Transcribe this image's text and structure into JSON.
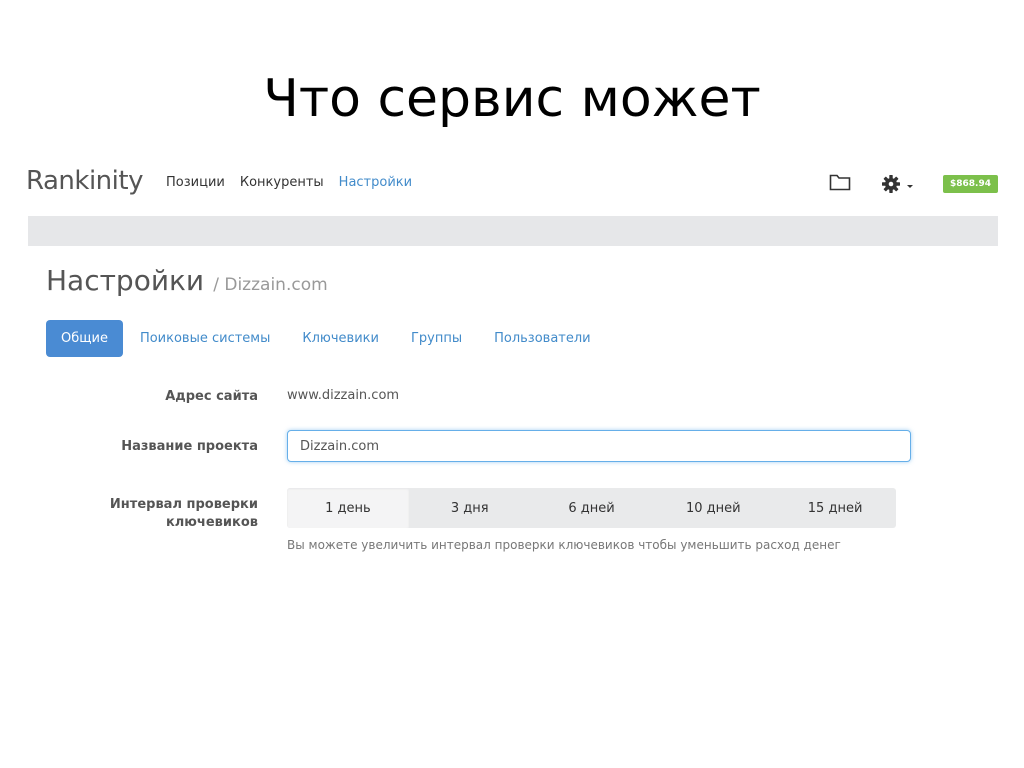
{
  "slide": {
    "title": "Что сервис может"
  },
  "navbar": {
    "brand": "Rankinity",
    "links": [
      {
        "label": "Позиции",
        "active": false
      },
      {
        "label": "Конкуренты",
        "active": false
      },
      {
        "label": "Настройки",
        "active": true
      }
    ],
    "icons": [
      "folder-icon",
      "gear-icon",
      "caret-down-icon"
    ],
    "balance": "$868.94",
    "balance_color": "#7cc04b"
  },
  "page": {
    "title": "Настройки",
    "subtitle": "/ Dizzain.com"
  },
  "tabs": [
    {
      "label": "Общие",
      "active": true
    },
    {
      "label": "Поиковые системы",
      "active": false
    },
    {
      "label": "Ключевики",
      "active": false
    },
    {
      "label": "Группы",
      "active": false
    },
    {
      "label": "Пользователи",
      "active": false
    }
  ],
  "form": {
    "site_address": {
      "label": "Адрес сайта",
      "value": "www.dizzain.com"
    },
    "project_name": {
      "label": "Название проекта",
      "value": "Dizzain.com"
    },
    "check_interval": {
      "label_line1": "Интервал проверки",
      "label_line2": "ключевиков",
      "options": [
        "1 день",
        "3 дня",
        "6 дней",
        "10 дней",
        "15 дней"
      ],
      "selected": "1 день",
      "help": "Вы можете увеличить интервал проверки ключевиков чтобы уменьшить расход денег"
    }
  },
  "colors": {
    "accent": "#428bca",
    "active_tab": "#4a8bd3",
    "grey_bar": "#e6e7e9"
  }
}
